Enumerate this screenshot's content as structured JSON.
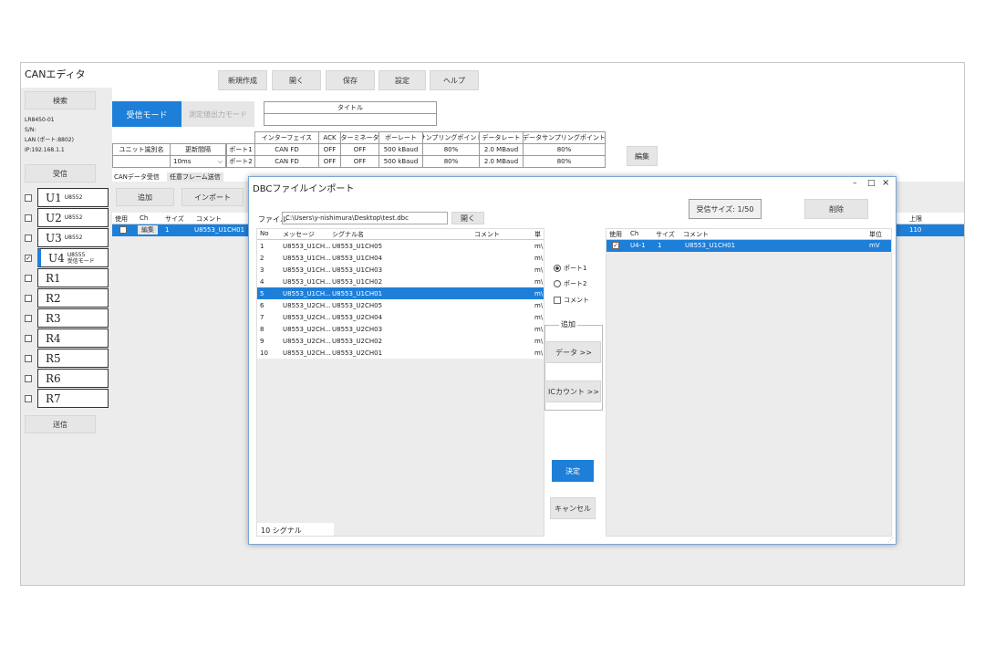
{
  "app": {
    "title": "CANエディタ"
  },
  "toolbar": {
    "new": "新規作成",
    "open": "開く",
    "save": "保存",
    "settings": "設定",
    "help": "ヘルプ"
  },
  "sidebar": {
    "search": "検索",
    "device_info": [
      "LR8450-01",
      "S/N:",
      "LAN (ポート:8802)",
      "IP:192.168.1.1"
    ],
    "receive": "受信",
    "send": "送信",
    "units": [
      {
        "name": "U1",
        "sub": "U8552",
        "sub2": "",
        "checked": false
      },
      {
        "name": "U2",
        "sub": "U8552",
        "sub2": "",
        "checked": false
      },
      {
        "name": "U3",
        "sub": "U8552",
        "sub2": "",
        "checked": false
      },
      {
        "name": "U4",
        "sub": "U8555",
        "sub2": "受信モード",
        "checked": true
      },
      {
        "name": "R1",
        "sub": "",
        "sub2": "",
        "checked": false
      },
      {
        "name": "R2",
        "sub": "",
        "sub2": "",
        "checked": false
      },
      {
        "name": "R3",
        "sub": "",
        "sub2": "",
        "checked": false
      },
      {
        "name": "R4",
        "sub": "",
        "sub2": "",
        "checked": false
      },
      {
        "name": "R5",
        "sub": "",
        "sub2": "",
        "checked": false
      },
      {
        "name": "R6",
        "sub": "",
        "sub2": "",
        "checked": false
      },
      {
        "name": "R7",
        "sub": "",
        "sub2": "",
        "checked": false
      }
    ]
  },
  "mode": {
    "receive": "受信モード",
    "measure": "測定値出力モード",
    "title_label": "タイトル",
    "title_value": ""
  },
  "unit_table": {
    "id_label": "ユニット識別名",
    "interval_label": "更新間隔",
    "interval_value": "10ms"
  },
  "port_table": {
    "headers": [
      "インターフェイス",
      "ACK",
      "ターミネータ",
      "ボーレート",
      "サンプリングポイント",
      "データレート",
      "データサンプリングポイント"
    ],
    "rows": [
      {
        "label": "ポート1",
        "cells": [
          "CAN FD",
          "OFF",
          "OFF",
          "500 kBaud",
          "80%",
          "2.0 MBaud",
          "80%"
        ]
      },
      {
        "label": "ポート2",
        "cells": [
          "CAN FD",
          "OFF",
          "OFF",
          "500 kBaud",
          "80%",
          "2.0 MBaud",
          "80%"
        ]
      }
    ],
    "edit": "編集"
  },
  "subtabs": {
    "can_receive": "CANデータ受信",
    "frame_send": "任意フレーム送信"
  },
  "main_list": {
    "add": "追加",
    "import": "インポート",
    "headers": {
      "use": "使用",
      "ch": "Ch",
      "size": "サイズ",
      "comment": "コメント",
      "upper": "上限"
    },
    "row": {
      "edit": "編集",
      "ch": "1",
      "comment": "U8553_U1CH01",
      "upper": "110"
    }
  },
  "dialog": {
    "title": "DBCファイルインポート",
    "controls": {
      "minimize": "–",
      "maximize": "□",
      "close": "×"
    },
    "file_label": "ファイル",
    "file_path": "C:\\Users\\y-nishimura\\Desktop\\test.dbc",
    "open": "開く",
    "receive_size": "受信サイズ: 1/50",
    "delete": "削除",
    "left_headers": {
      "no": "No",
      "message": "メッセージ",
      "signal": "シグナル名",
      "comment": "コメント",
      "unit": "単"
    },
    "signals": [
      {
        "no": "1",
        "message": "U8553_U1CH...",
        "signal": "U8553_U1CH05",
        "unit": "m\\"
      },
      {
        "no": "2",
        "message": "U8553_U1CH...",
        "signal": "U8553_U1CH04",
        "unit": "m\\"
      },
      {
        "no": "3",
        "message": "U8553_U1CH...",
        "signal": "U8553_U1CH03",
        "unit": "m\\"
      },
      {
        "no": "4",
        "message": "U8553_U1CH...",
        "signal": "U8553_U1CH02",
        "unit": "m\\"
      },
      {
        "no": "5",
        "message": "U8553_U1CH...",
        "signal": "U8553_U1CH01",
        "unit": "m\\"
      },
      {
        "no": "6",
        "message": "U8553_U2CH...",
        "signal": "U8553_U2CH05",
        "unit": "m\\"
      },
      {
        "no": "7",
        "message": "U8553_U2CH...",
        "signal": "U8553_U2CH04",
        "unit": "m\\"
      },
      {
        "no": "8",
        "message": "U8553_U2CH...",
        "signal": "U8553_U2CH03",
        "unit": "m\\"
      },
      {
        "no": "9",
        "message": "U8553_U2CH...",
        "signal": "U8553_U2CH02",
        "unit": "m\\"
      },
      {
        "no": "10",
        "message": "U8553_U2CH...",
        "signal": "U8553_U2CH01",
        "unit": "m\\"
      }
    ],
    "selected_index": 4,
    "signal_count": "10 シグナル",
    "port1": "ポート1",
    "port2": "ポート2",
    "comment_check": "コメント",
    "add_group": "追加",
    "data_btn": "データ >>",
    "counter_btn": "ICカウント >>",
    "ok": "決定",
    "cancel": "キャンセル",
    "right_headers": {
      "use": "使用",
      "ch": "Ch",
      "size": "サイズ",
      "comment": "コメント",
      "unit": "単位"
    },
    "right_row": {
      "ch": "U4-1",
      "size": "1",
      "comment": "U8553_U1CH01",
      "unit": "mV"
    }
  },
  "colors": {
    "accent": "#1e7fd9",
    "panel": "#ececec",
    "button": "#e6e6e6"
  }
}
